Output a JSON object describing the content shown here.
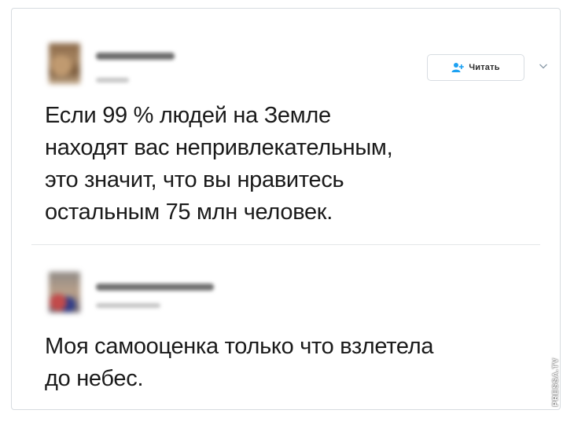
{
  "tweets": [
    {
      "text": "Если 99 % людей на Земле\nнаходят вас непривлекательным,\nэто значит, что вы нравитесь\nостальным 75 млн человек.",
      "follow_button": {
        "label": "Читать",
        "icon": "add-user-icon"
      },
      "menu_icon": "chevron-down-icon"
    },
    {
      "text": "Моя самооценка только что взлетела\nдо небес."
    }
  ],
  "watermark": "PRESSA.TV",
  "colors": {
    "border": "#d7dce0",
    "text": "#1a1a1a",
    "divider": "#e3e6e9",
    "follow_icon": "#1da1f2"
  }
}
